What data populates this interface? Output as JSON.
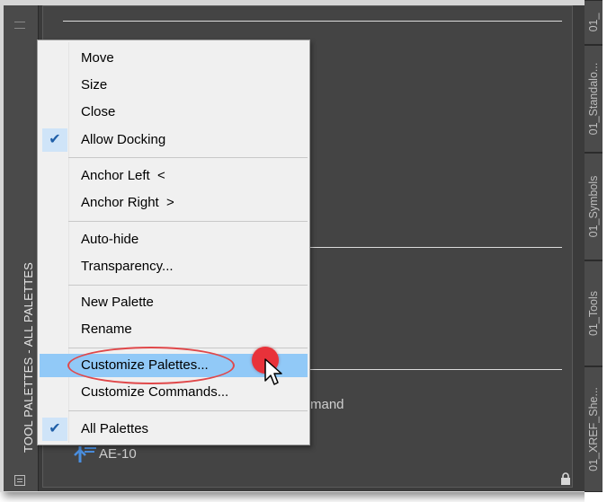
{
  "palette": {
    "title": "TOOL PALETTES - ALL PALETTES",
    "visible_tool_text": "mand",
    "tool_label": "AE-10"
  },
  "tabs": [
    {
      "label": "01_"
    },
    {
      "label": "01_Standalo..."
    },
    {
      "label": "01_Symbols"
    },
    {
      "label": "01_Tools"
    },
    {
      "label": "01_XREF_She..."
    }
  ],
  "menu": {
    "items": [
      {
        "label": "Move",
        "checked": false
      },
      {
        "label": "Size",
        "checked": false
      },
      {
        "label": "Close",
        "checked": false
      },
      {
        "label": "Allow Docking",
        "checked": true
      },
      {
        "label": "Anchor Left  <",
        "checked": false
      },
      {
        "label": "Anchor Right  >",
        "checked": false
      },
      {
        "label": "Auto-hide",
        "checked": false
      },
      {
        "label": "Transparency...",
        "checked": false
      },
      {
        "label": "New Palette",
        "checked": false
      },
      {
        "label": "Rename",
        "checked": false
      },
      {
        "label": "Customize Palettes...",
        "checked": false,
        "highlighted": true
      },
      {
        "label": "Customize Commands...",
        "checked": false
      },
      {
        "label": "All Palettes",
        "checked": true
      }
    ]
  },
  "icons": {
    "check": "✔",
    "lock": "lock-icon",
    "properties": "properties-icon",
    "tool": "dimension-tool-icon",
    "cursor": "arrow-cursor-icon"
  },
  "colors": {
    "highlight": "#91c9f7",
    "annotation_red": "#e0484a",
    "palette_bg": "#444444"
  }
}
